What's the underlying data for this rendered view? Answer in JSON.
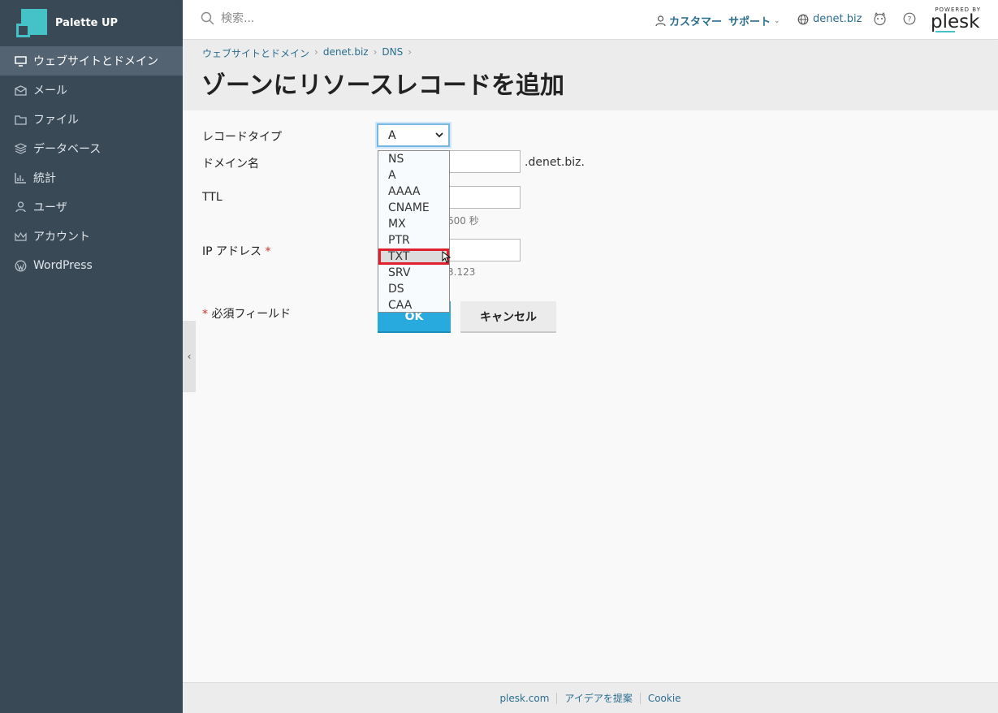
{
  "app": {
    "brand": "Palette UP"
  },
  "sidebar": {
    "items": [
      {
        "label": "ウェブサイトとドメイン",
        "icon": "monitor-icon",
        "active": true
      },
      {
        "label": "メール",
        "icon": "mail-icon"
      },
      {
        "label": "ファイル",
        "icon": "folder-icon"
      },
      {
        "label": "データベース",
        "icon": "database-icon"
      },
      {
        "label": "統計",
        "icon": "chart-icon"
      },
      {
        "label": "ユーザ",
        "icon": "user-icon"
      },
      {
        "label": "アカウント",
        "icon": "crown-icon"
      },
      {
        "label": "WordPress",
        "icon": "wordpress-icon"
      }
    ]
  },
  "header": {
    "search_placeholder": "検索...",
    "customer": "カスタマー",
    "support": "サポート",
    "domain": "denet.biz",
    "powered_by": "POWERED BY",
    "plesk": "plesk"
  },
  "breadcrumb": [
    "ウェブサイトとドメイン",
    "denet.biz",
    "DNS"
  ],
  "page_title": "ゾーンにリソースレコードを追加",
  "form": {
    "record_type_label": "レコードタイプ",
    "record_type_value": "A",
    "domain_name_label": "ドメイン名",
    "domain_suffix": ".denet.biz.",
    "ttl_label": "TTL",
    "ttl_hint_visible": "600 秒",
    "ip_label": "IP アドレス",
    "ip_hint_visible": "3.123",
    "required_star": "*",
    "required_note": "必須フィールド",
    "ok": "OK",
    "cancel": "キャンセル"
  },
  "dropdown": {
    "options": [
      "NS",
      "A",
      "AAAA",
      "CNAME",
      "MX",
      "PTR",
      "TXT",
      "SRV",
      "DS",
      "CAA"
    ],
    "highlighted": "TXT"
  },
  "footer": [
    "plesk.com",
    "アイデアを提案",
    "Cookie"
  ],
  "colors": {
    "sidebar": "#3a4956",
    "accent": "#28aade",
    "highlight_box": "#e0202e",
    "link": "#2a6d8f"
  }
}
